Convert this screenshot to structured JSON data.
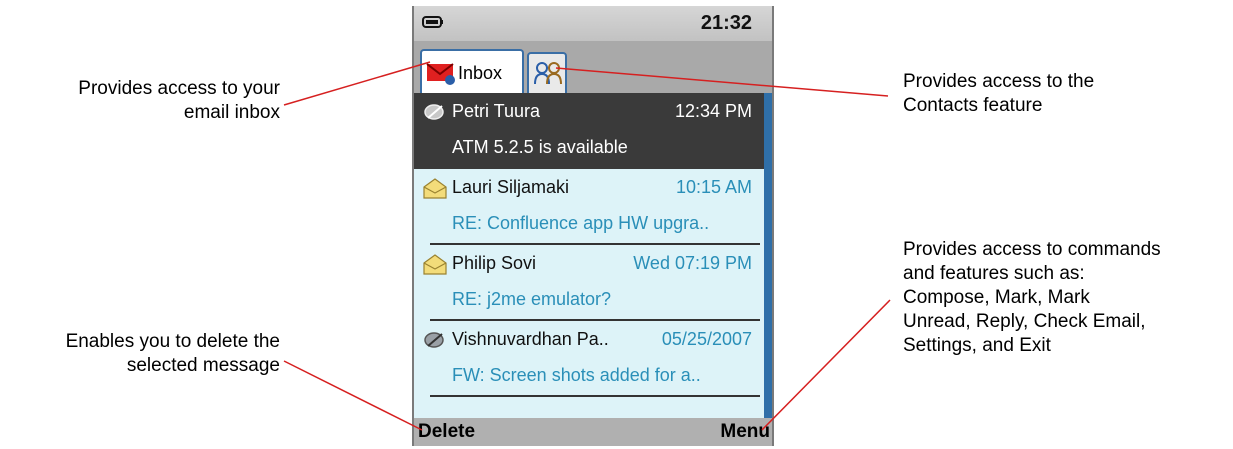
{
  "callouts": {
    "inbox_line1": "Provides access to your",
    "inbox_line2": "email inbox",
    "contacts_line1": "Provides access to the",
    "contacts_line2": "Contacts feature",
    "delete_line1": "Enables you to delete the",
    "delete_line2": "selected message",
    "menu_line1": "Provides access to commands",
    "menu_line2": "and features such as:",
    "menu_line3": "Compose, Mark, Mark",
    "menu_line4": "Unread, Reply, Check Email,",
    "menu_line5": "Settings, and Exit"
  },
  "status": {
    "clock": "21:32",
    "battery_icon": "battery-icon"
  },
  "tabs": [
    {
      "label": "Inbox",
      "icon": "mail-icon",
      "active": true
    },
    {
      "label": "",
      "icon": "contacts-icon",
      "active": false
    }
  ],
  "messages": [
    {
      "sender": "Petri Tuura",
      "time": "12:34 PM",
      "subject": "ATM 5.2.5 is available",
      "icon": "opened-mail-icon",
      "selected": true
    },
    {
      "sender": "Lauri Siljamaki",
      "time": "10:15 AM",
      "subject": "RE: Confluence app HW upgra..",
      "icon": "open-envelope-icon",
      "selected": false
    },
    {
      "sender": "Philip Sovi",
      "time": "Wed 07:19 PM",
      "subject": "RE: j2me emulator?",
      "icon": "open-envelope-icon",
      "selected": false
    },
    {
      "sender": "Vishnuvardhan Pa..",
      "time": "05/25/2007",
      "subject": "FW: Screen shots added for a..",
      "icon": "opened-mail-icon",
      "selected": false
    }
  ],
  "softkeys": {
    "left": "Delete",
    "right": "Menu"
  },
  "colors": {
    "accent": "#2a8fb8",
    "list_bg": "#ddf3f8",
    "selected_bg": "#3a3a3a",
    "leader_line": "#d62020",
    "scrollbar": "#2f6fa8"
  }
}
